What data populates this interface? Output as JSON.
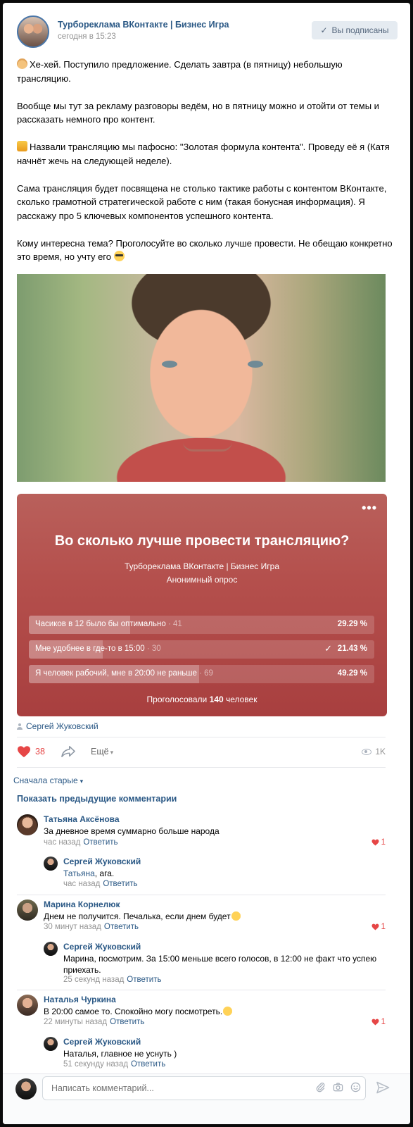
{
  "post": {
    "group_name": "Турбореклама ВКонтакте | Бизнес Игра",
    "time": "сегодня в 15:23",
    "subscribed_label": "Вы подписаны",
    "paragraphs": [
      "Хе-хей. Поступило предложение. Сделать завтра (в пятницу) небольшую трансляцию.",
      "Вообще мы тут за рекламу разговоры ведём, но в пятницу можно и отойти от темы и рассказать немного про контент.",
      "Назвали трансляцию мы пафосно: \"Золотая формула контента\". Проведу её я (Катя начнёт жечь на следующей неделе).",
      "Сама трансляция будет посвящена не столько тактике работы с контентом ВКонтакте, сколько грамотной стратегической работе с ним (такая бонусная информация). Я расскажу про 5 ключевых компонентов успешного контента.",
      "Кому интересна тема? Проголосуйте во сколько лучше провести. Не обещаю конкретно это время, но учту его"
    ],
    "signer": "Сергей Жуковский",
    "likes": "38",
    "more_label": "Ещё",
    "views": "1K"
  },
  "poll": {
    "title": "Во сколько лучше провести трансляцию?",
    "author": "Турбореклама ВКонтакте | Бизнес Игра",
    "type": "Анонимный опрос",
    "options": [
      {
        "label": "Часиков в 12 было бы оптимально",
        "count": "· 41",
        "percent_text": "29.29 %",
        "percent": 29.29,
        "voted": false
      },
      {
        "label": "Мне удобнее в где-то в 15:00",
        "count": "· 30",
        "percent_text": "21.43 %",
        "percent": 21.43,
        "voted": true
      },
      {
        "label": "Я человек рабочий, мне в 20:00 не раньше",
        "count": "· 69",
        "percent_text": "49.29 %",
        "percent": 49.29,
        "voted": false
      }
    ],
    "total_prefix": "Проголосовали",
    "total_count": "140",
    "total_suffix": "человек"
  },
  "comments": {
    "sort_label": "Сначала старые",
    "show_previous": "Показать предыдущие комментарии",
    "reply_label": "Ответить",
    "items": [
      {
        "author": "Татьяна Аксёнова",
        "text": "За дневное время суммарно больше народа",
        "time": "час назад",
        "likes": "1"
      },
      {
        "author": "Сергей Жуковский",
        "mention": "Татьяна",
        "text": ", ага.",
        "time": "час назад"
      },
      {
        "author": "Марина Корнелюк",
        "text": "Днем не получится. Печалька, если днем будет",
        "time": "30 минут назад",
        "likes": "1"
      },
      {
        "author": "Сергей Жуковский",
        "text": "Марина, посмотрим. За 15:00 меньше всего голосов, в 12:00 не факт что успею приехать.",
        "time": "25 секунд назад"
      },
      {
        "author": "Наталья Чуркина",
        "text": "В 20:00 самое то. Спокойно могу посмотреть.",
        "time": "22 минуты назад",
        "likes": "1"
      },
      {
        "author": "Сергей Жуковский",
        "text": "Наталья, главное не уснуть )",
        "time": "51 секунду назад"
      }
    ],
    "composer_placeholder": "Написать комментарий..."
  },
  "colors": {
    "link": "#2a5885",
    "like": "#e64646",
    "poll_bg": "#b44f4c"
  }
}
